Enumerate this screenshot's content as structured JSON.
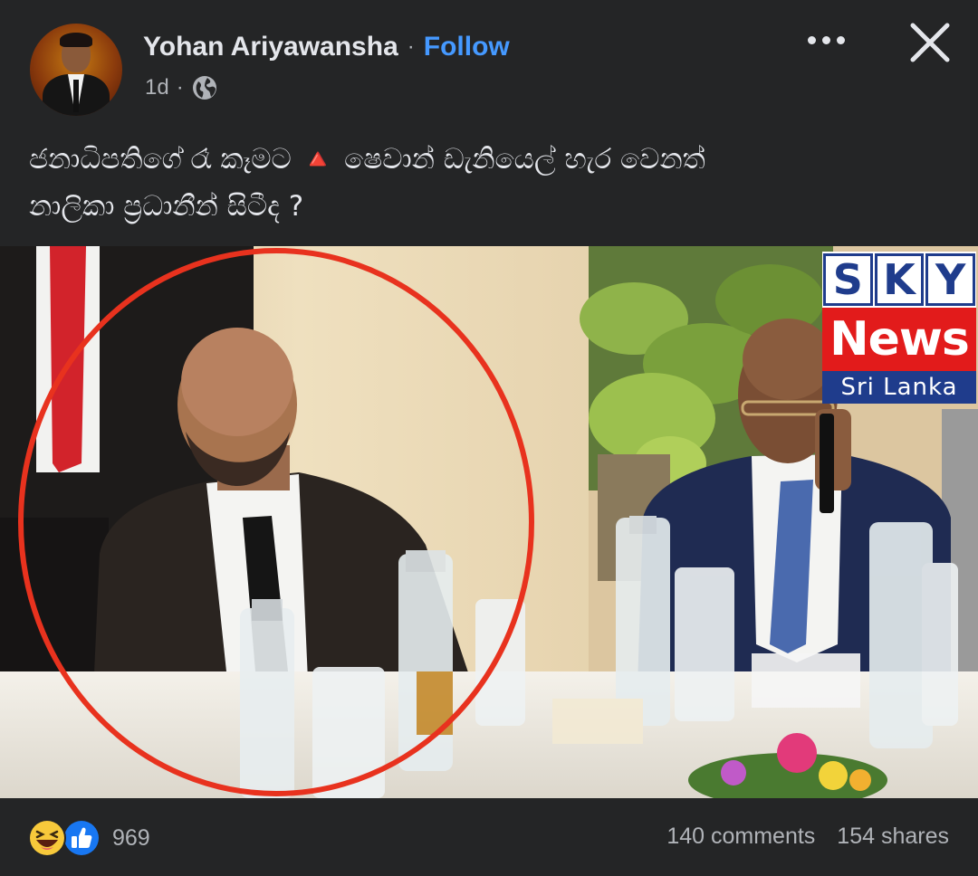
{
  "post": {
    "author": "Yohan Ariyawansha",
    "separator": "·",
    "follow_label": "Follow",
    "time": "1d",
    "meta_separator": "·",
    "visibility_icon": "globe-icon",
    "more_icon": "more-options-icon",
    "close_icon": "close-icon",
    "caption_line1": "ජනාධිපතිගේ රෑ කෑමට 🔺 ෂෙවාන් ඩැනියෙල් හැර වෙනත්",
    "caption_line2": "නාලිකා ප්‍රධානීන් සිටීද ?"
  },
  "photo": {
    "watermark": {
      "letters": [
        "S",
        "K",
        "Y"
      ],
      "word": "News",
      "region": "Sri Lanka"
    },
    "highlight_color": "#e8321e"
  },
  "footer": {
    "reaction_icons": [
      "haha-reaction-icon",
      "like-reaction-icon"
    ],
    "reaction_count": "969",
    "comments": "140 comments",
    "shares": "154 shares"
  },
  "colors": {
    "background": "#242526",
    "text": "#e4e6eb",
    "secondary_text": "#b0b3b8",
    "link": "#4599ff",
    "sky_blue": "#1f3c8c",
    "sky_red": "#e21b1b"
  }
}
